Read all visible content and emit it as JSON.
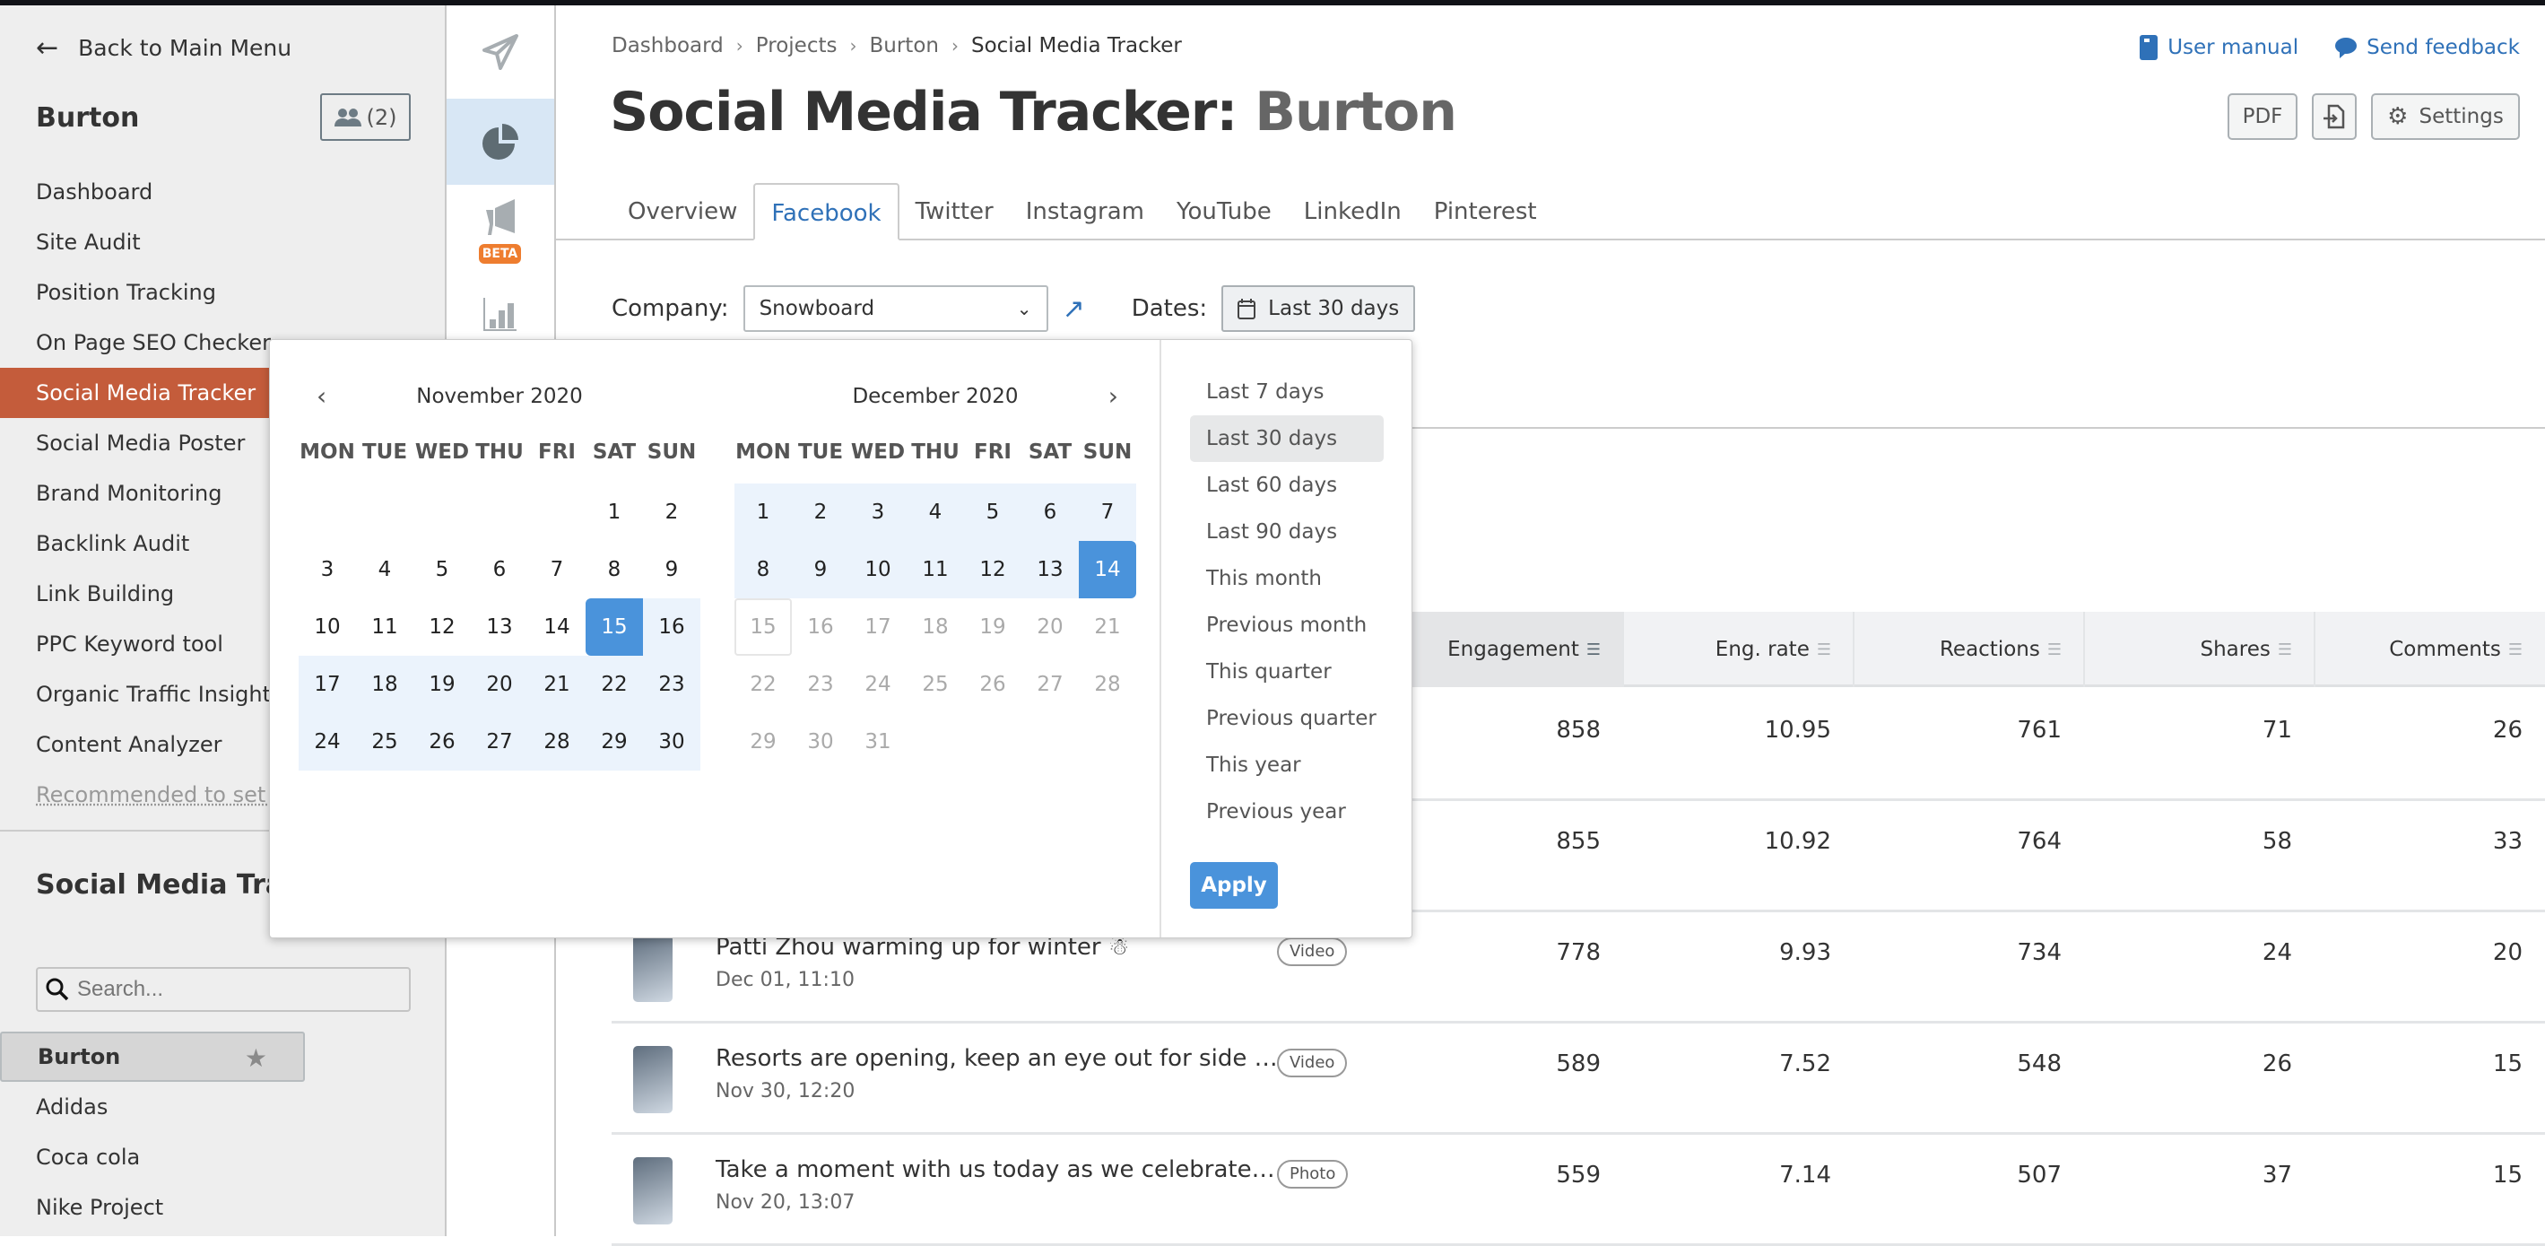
{
  "sidebar": {
    "back_label": "Back to Main Menu",
    "project_name": "Burton",
    "users_count": "(2)",
    "nav": [
      {
        "label": "Dashboard"
      },
      {
        "label": "Site Audit"
      },
      {
        "label": "Position Tracking"
      },
      {
        "label": "On Page SEO Checker"
      },
      {
        "label": "Social Media Tracker",
        "active": true
      },
      {
        "label": "Social Media Poster"
      },
      {
        "label": "Brand Monitoring"
      },
      {
        "label": "Backlink Audit"
      },
      {
        "label": "Link Building"
      },
      {
        "label": "PPC Keyword tool"
      },
      {
        "label": "Organic Traffic Insights"
      },
      {
        "label": "Content Analyzer"
      }
    ],
    "recommended_label": "Recommended to set up",
    "campaigns_title": "Social Media Tracker Campaigns",
    "search_placeholder": "Search...",
    "campaigns": [
      {
        "label": "Burton",
        "selected": true,
        "starred": true
      },
      {
        "label": "Adidas"
      },
      {
        "label": "Coca cola"
      },
      {
        "label": "Nike Project"
      }
    ]
  },
  "rail": {
    "beta_label": "BETA"
  },
  "header": {
    "breadcrumb": [
      "Dashboard",
      "Projects",
      "Burton",
      "Social Media Tracker"
    ],
    "title": "Social Media Tracker:",
    "title_project": "Burton",
    "user_manual": "User manual",
    "send_feedback": "Send feedback",
    "pdf_label": "PDF",
    "settings_label": "Settings"
  },
  "tabs": [
    {
      "label": "Overview"
    },
    {
      "label": "Facebook",
      "active": true
    },
    {
      "label": "Twitter"
    },
    {
      "label": "Instagram"
    },
    {
      "label": "YouTube"
    },
    {
      "label": "LinkedIn"
    },
    {
      "label": "Pinterest"
    }
  ],
  "filters": {
    "company_label": "Company:",
    "company_value": "Snowboard",
    "dates_label": "Dates:",
    "dates_value": "Last 30 days"
  },
  "table": {
    "columns": [
      "Engagement",
      "Eng. rate",
      "Reactions",
      "Shares",
      "Comments"
    ],
    "sorted_column": "Engagement",
    "rows": [
      {
        "title": "",
        "date": "",
        "type": "",
        "engagement": "858",
        "eng_rate": "10.95",
        "reactions": "761",
        "shares": "71",
        "comments": "26"
      },
      {
        "title": "",
        "date": "",
        "type": "",
        "engagement": "855",
        "eng_rate": "10.92",
        "reactions": "764",
        "shares": "58",
        "comments": "33"
      },
      {
        "title": "Patti Zhou warming up for winter ☃",
        "date": "Dec 01, 11:10",
        "type": "Video",
        "engagement": "778",
        "eng_rate": "9.93",
        "reactions": "734",
        "shares": "24",
        "comments": "20"
      },
      {
        "title": "Resorts are opening, keep an eye out for side …",
        "date": "Nov 30, 12:20",
        "type": "Video",
        "engagement": "589",
        "eng_rate": "7.52",
        "reactions": "548",
        "shares": "26",
        "comments": "15"
      },
      {
        "title": "Take a moment with us today as we celebrate…",
        "date": "Nov 20, 13:07",
        "type": "Photo",
        "engagement": "559",
        "eng_rate": "7.14",
        "reactions": "507",
        "shares": "37",
        "comments": "15"
      }
    ]
  },
  "datepicker": {
    "weekdays": [
      "MON",
      "TUE",
      "WED",
      "THU",
      "FRI",
      "SAT",
      "SUN"
    ],
    "left_month": "November 2020",
    "right_month": "December 2020",
    "left_first_weekday": 6,
    "left_days": 30,
    "right_first_weekday": 1,
    "right_days": 31,
    "range_start": "2020-11-15",
    "range_end": "2020-12-14",
    "today": "2020-12-15",
    "presets": [
      "Last 7 days",
      "Last 30 days",
      "Last 60 days",
      "Last 90 days",
      "This month",
      "Previous month",
      "This quarter",
      "Previous quarter",
      "This year",
      "Previous year"
    ],
    "active_preset": "Last 30 days",
    "apply_label": "Apply",
    "accent": "#4a93db",
    "range_bg": "#ebf3fc"
  },
  "colors": {
    "active_nav": "#c45c3b",
    "link": "#2f71b8",
    "beta": "#ee7d2f"
  }
}
